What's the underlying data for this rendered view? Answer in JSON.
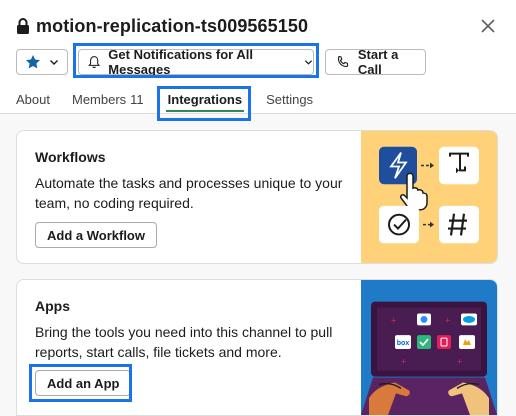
{
  "header": {
    "title": "motion-replication-ts009565150",
    "notifications_label": "Get Notifications for All Messages",
    "call_label": "Start a Call",
    "tabs": [
      {
        "label": "About"
      },
      {
        "label": "Members",
        "count": "11"
      },
      {
        "label": "Integrations"
      },
      {
        "label": "Settings"
      }
    ]
  },
  "workflows": {
    "title": "Workflows",
    "description": "Automate the tasks and processes unique to your team, no coding required.",
    "button_label": "Add a Workflow"
  },
  "apps": {
    "title": "Apps",
    "description": "Bring the tools you need into this channel to pull reports, start calls, file tickets and more.",
    "button_label": "Add an App",
    "illustration_logos": [
      "box"
    ]
  },
  "colors": {
    "highlight": "#1a73e8",
    "active_tab_underline": "#2e8b57",
    "star": "#1264a3",
    "workflow_bg": "#ffd27a",
    "apps_bg": "#1f7ac7"
  },
  "icons": [
    "lock-icon",
    "close-icon",
    "star-icon",
    "chevron-down-icon",
    "bell-icon",
    "phone-icon"
  ]
}
